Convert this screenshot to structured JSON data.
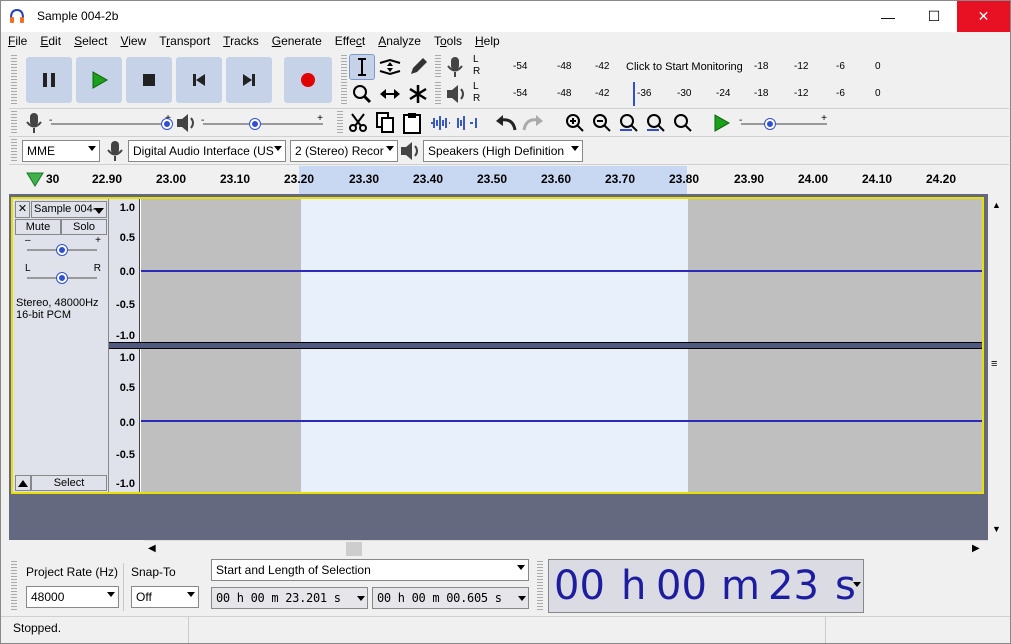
{
  "window": {
    "title": "Sample 004-2b",
    "minimize": "—",
    "maximize": "☐",
    "close": "✕"
  },
  "menus": [
    "File",
    "Edit",
    "Select",
    "View",
    "Transport",
    "Tracks",
    "Generate",
    "Effect",
    "Analyze",
    "Tools",
    "Help"
  ],
  "menu_underline": [
    "F",
    "E",
    "S",
    "V",
    "r",
    "T",
    "G",
    "c",
    "A",
    "o",
    "H"
  ],
  "transport": {
    "buttons": [
      "pause",
      "play",
      "stop",
      "skip-start",
      "skip-end",
      "record"
    ]
  },
  "tools": [
    "selection",
    "envelope",
    "draw",
    "zoom",
    "time-shift",
    "multi"
  ],
  "record_meter": {
    "ticks": [
      "-54",
      "-48",
      "-42",
      "-18",
      "-12",
      "-6",
      "0"
    ],
    "message": "Click to Start Monitoring",
    "channels": [
      "L",
      "R"
    ]
  },
  "play_meter": {
    "ticks": [
      "-54",
      "-48",
      "-42",
      "-36",
      "-30",
      "-24",
      "-18",
      "-12",
      "-6",
      "0"
    ],
    "channels": [
      "L",
      "R"
    ]
  },
  "device": {
    "host": "MME",
    "input": "Digital Audio Interface (US",
    "channels": "2 (Stereo) Recor",
    "output": "Speakers (High Definition"
  },
  "ruler": {
    "ticks": [
      "30",
      "22.90",
      "23.00",
      "23.10",
      "23.20",
      "23.30",
      "23.40",
      "23.50",
      "23.60",
      "23.70",
      "23.80",
      "23.90",
      "24.00",
      "24.10",
      "24.20"
    ]
  },
  "track": {
    "name": "Sample 004-",
    "mute": "Mute",
    "solo": "Solo",
    "gain_minus": "–",
    "gain_plus": "+",
    "pan_left": "L",
    "pan_right": "R",
    "info_line1": "Stereo, 48000Hz",
    "info_line2": "16-bit PCM",
    "select": "Select",
    "scale": [
      "1.0",
      "0.5",
      "0.0",
      "-0.5",
      "-1.0"
    ]
  },
  "selection_toolbar": {
    "project_rate_label": "Project Rate (Hz)",
    "project_rate": "48000",
    "snap_label": "Snap-To",
    "snap": "Off",
    "mode": "Start and Length of Selection",
    "start": "00 h 00 m 23.201 s",
    "length": "00 h 00 m 00.605 s"
  },
  "time_display": {
    "hh": "00",
    "h": "h",
    "mm": "00",
    "m": "m",
    "ss": "23",
    "s": "s"
  },
  "status": "Stopped.",
  "colors": {
    "accent": "#2d2ab8",
    "selection": "#e8f0fc",
    "unselected_wave": "#bfbfbf",
    "track_bg": "#64697f",
    "button_blue": "#c5d2e8"
  }
}
